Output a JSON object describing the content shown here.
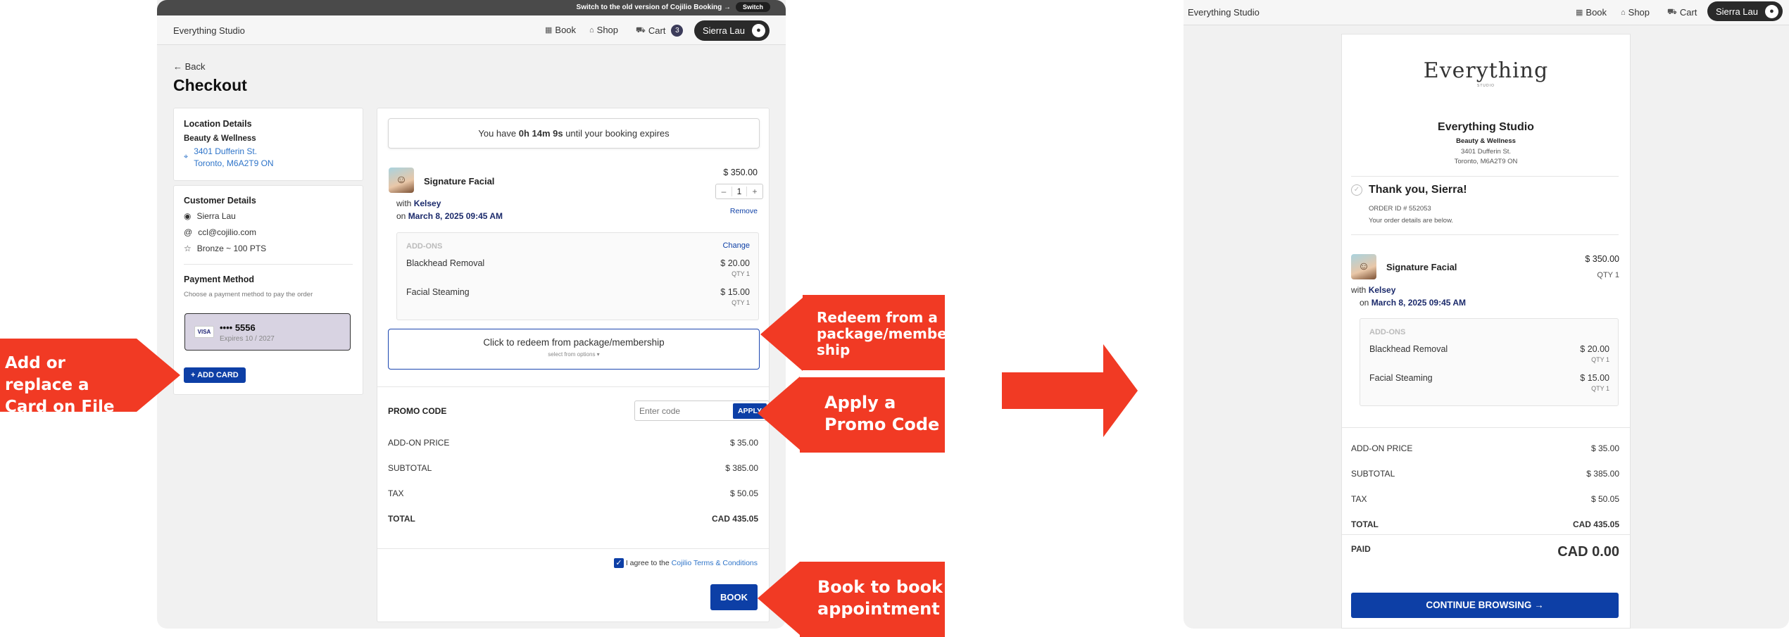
{
  "left": {
    "topbar": {
      "notice": "Switch to the old version of Cojilio Booking →",
      "switch_label": "Switch"
    },
    "nav": {
      "brand": "Everything Studio",
      "book": "Book",
      "shop": "Shop",
      "cart": "Cart",
      "cart_count": "3",
      "user": "Sierra Lau"
    },
    "back": "Back",
    "title": "Checkout",
    "location": {
      "heading": "Location Details",
      "category": "Beauty & Wellness",
      "address1": "3401 Dufferin St.",
      "address2": "Toronto, M6A2T9 ON"
    },
    "customer": {
      "heading": "Customer Details",
      "name": "Sierra Lau",
      "email": "ccl@cojilio.com",
      "points": "Bronze ~ 100 PTS"
    },
    "payment": {
      "heading": "Payment Method",
      "hint": "Choose a payment method to pay the order",
      "card_brand": "VISA",
      "card_number": "•••• 5556",
      "card_expiry": "Expires 10 / 2027",
      "add_card": "+ ADD CARD"
    },
    "timer": {
      "prefix": "You have ",
      "time": "0h 14m 9s",
      "suffix": " until your booking expires"
    },
    "service": {
      "name": "Signature Facial",
      "price": "$ 350.00",
      "qty": "1",
      "remove": "Remove",
      "with": "with ",
      "staff": "Kelsey",
      "on": "on ",
      "date": "March 8, 2025 09:45 AM"
    },
    "addons": {
      "heading": "ADD-ONS",
      "change": "Change",
      "items": [
        {
          "name": "Blackhead Removal",
          "price": "$ 20.00",
          "qty": "QTY 1"
        },
        {
          "name": "Facial Steaming",
          "price": "$ 15.00",
          "qty": "QTY 1"
        }
      ]
    },
    "redeem": {
      "title": "Click to redeem from package/membership",
      "sub": "select from options ▾"
    },
    "promo": {
      "label": "PROMO CODE",
      "placeholder": "Enter code",
      "apply": "APPLY"
    },
    "totals": {
      "addon_label": "ADD-ON PRICE",
      "addon": "$ 35.00",
      "subtotal_label": "SUBTOTAL",
      "subtotal": "$ 385.00",
      "tax_label": "TAX",
      "tax": "$ 50.05",
      "total_label": "TOTAL",
      "total": "CAD 435.05"
    },
    "agree": {
      "text": "I agree to the ",
      "link": "Cojilio Terms & Conditions"
    },
    "book_button": "BOOK"
  },
  "callouts": {
    "add_card": "Add or replace a Card on File",
    "redeem": "Redeem from a package/member ship",
    "promo": "Apply a Promo Code",
    "book": "Book to book appointment"
  },
  "right": {
    "nav": {
      "brand": "Everything Studio",
      "book": "Book",
      "shop": "Shop",
      "cart": "Cart",
      "user": "Sierra Lau"
    },
    "logo": {
      "word": "Everything",
      "sub": "STUDIO"
    },
    "studio": {
      "name": "Everything Studio",
      "category": "Beauty & Wellness",
      "address1": "3401 Dufferin St.",
      "address2": "Toronto, M6A2T9 ON"
    },
    "thanks": {
      "title": "Thank you, Sierra!",
      "order": "ORDER ID # 552053",
      "note": "Your order details are below."
    },
    "service": {
      "name": "Signature Facial",
      "price": "$ 350.00",
      "qty": "QTY 1",
      "with": "with ",
      "staff": "Kelsey",
      "on": "on ",
      "date": "March 8, 2025 09:45 AM"
    },
    "addons": {
      "heading": "ADD-ONS",
      "items": [
        {
          "name": "Blackhead Removal",
          "price": "$ 20.00",
          "qty": "QTY 1"
        },
        {
          "name": "Facial Steaming",
          "price": "$ 15.00",
          "qty": "QTY 1"
        }
      ]
    },
    "totals": {
      "addon_label": "ADD-ON PRICE",
      "addon": "$ 35.00",
      "subtotal_label": "SUBTOTAL",
      "subtotal": "$ 385.00",
      "tax_label": "TAX",
      "tax": "$ 50.05",
      "total_label": "TOTAL",
      "total": "CAD 435.05",
      "paid_label": "PAID",
      "paid": "CAD 0.00"
    },
    "continue": "CONTINUE BROWSING →"
  },
  "colors": {
    "accent": "#0d3fa6",
    "callout": "#f13a24",
    "link": "#2e74c9"
  }
}
